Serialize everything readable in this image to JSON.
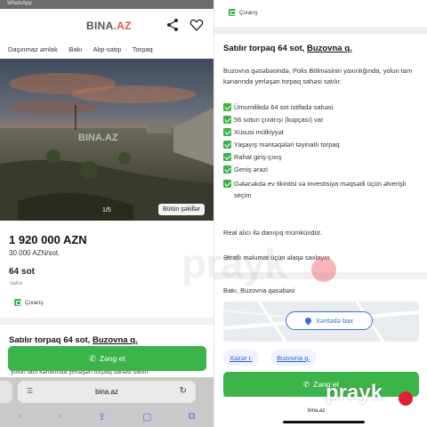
{
  "status_bar": {
    "app": "WhatsApp"
  },
  "left": {
    "logo": {
      "text": "BINA",
      "suffix": ".AZ"
    },
    "header_icons": [
      "share-icon",
      "heart-icon"
    ],
    "breadcrumbs": [
      "Daşınmaz əmlak",
      "Bakı",
      "Alqı-satqı",
      "Torpaq"
    ],
    "photo": {
      "watermark": "BINA.AZ",
      "counter": "1/5",
      "all_photos_button": "Bütün şəkillər"
    },
    "price": "1 920 000 AZN",
    "price_per_unit": "30 000 AZN/sot.",
    "area_value": "64 sot",
    "area_label": "sahə",
    "badge": "Çıxarış",
    "listing_title": {
      "prefix": "Satılır torpaq 64 sot, ",
      "place": "Buzovna q."
    },
    "call_button": "Zəng et",
    "cut_text": "yolun tam kənarında yerləşən torpaq sahəsi satılır.",
    "browser": {
      "url": "bina.az",
      "nav_icons": [
        "back-icon",
        "forward-icon",
        "share-icon",
        "bookmarks-icon",
        "tabs-icon"
      ]
    }
  },
  "right": {
    "badge": "Çıxarış",
    "listing_title": {
      "prefix": "Satılır torpaq 64 sot, ",
      "place": "Buzovna q."
    },
    "description_1": "Buzovna qəsəbəsində, Polis Bölməsinin yaxınlığında, yolun tam kənarında yerləşən torpaq sahəsi satılır.",
    "features": [
      "Ümumilikdə 64 sot istifadə sahəsi",
      "56 sotun çıxarışı (kupçası) var",
      "Xüsusi mülkiyyət",
      "Yaşayış məntəqələri təyinatlı torpaq",
      "Rahat giriş-çıxış",
      "Geniş ərazi",
      "Gələcəkdə ev tikintisi və investisiya məqsədi üçün əlverişli seçim"
    ],
    "note_1": "Real alıcı ilə danışıq mümkündür.",
    "note_2": "Ətraflı məlumat üçün əlaqə saxlayın.",
    "address": "Bakı, Buzovna qəsəbəsi",
    "map_button": "Xəritədə bax",
    "chips": [
      "Xəzər r.",
      "Buzovna q."
    ],
    "call_button": "Zəng et",
    "cut_text": "Ƶadlr",
    "url": "bina.az"
  },
  "watermarks": {
    "main": "prayk",
    "corner": "prayk"
  },
  "colors": {
    "accent_green": "#3bb54a",
    "link_blue": "#3a6fd8",
    "logo_dot": "#e05a4f"
  }
}
